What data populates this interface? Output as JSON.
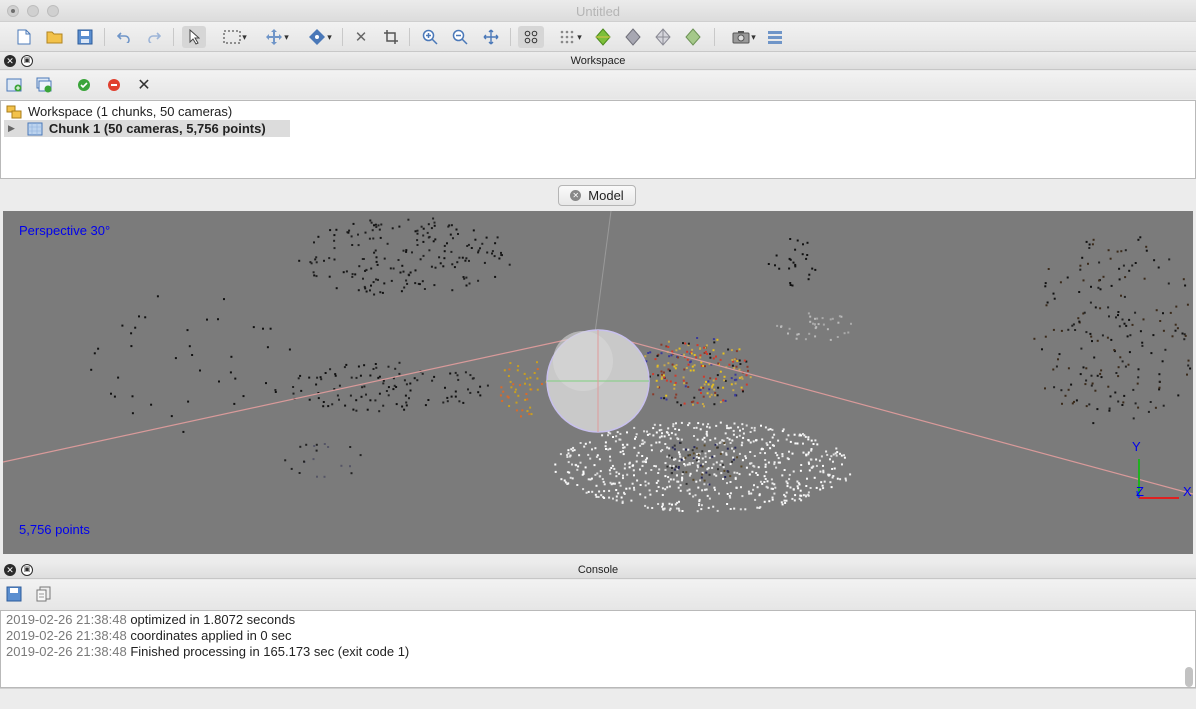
{
  "window": {
    "title": "Untitled"
  },
  "toolbar": {
    "icons": [
      "new-document",
      "open-folder",
      "save",
      "undo",
      "redo",
      "select-arrow",
      "rect-select",
      "move-object",
      "navigate",
      "delete",
      "crop",
      "zoom-in",
      "zoom-out",
      "fit",
      "grid-view",
      "points",
      "solid",
      "shaded",
      "wireframe",
      "textured",
      "camera",
      "layers"
    ]
  },
  "workspace": {
    "header": "Workspace",
    "root_label": "Workspace (1 chunks, 50 cameras)",
    "chunk_label": "Chunk 1 (50 cameras, 5,756 points)"
  },
  "model": {
    "tab_label": "Model",
    "projection": "Perspective 30°",
    "point_count": "5,756 points",
    "axes": {
      "x": "X",
      "y": "Y",
      "z": "Z"
    },
    "colors": {
      "background": "#7b7b7b",
      "label": "#0000ee",
      "axis_x": "#e02020",
      "axis_y": "#20b020",
      "axis_z": "#2040e0"
    }
  },
  "console": {
    "header": "Console",
    "lines": [
      {
        "time": "2019-02-26 21:38:48",
        "text": " optimized in 1.8072 seconds"
      },
      {
        "time": "2019-02-26 21:38:48",
        "text": " coordinates applied in 0 sec"
      },
      {
        "time": "2019-02-26 21:38:48",
        "text": " Finished processing in 165.173 sec (exit code 1)"
      }
    ]
  }
}
